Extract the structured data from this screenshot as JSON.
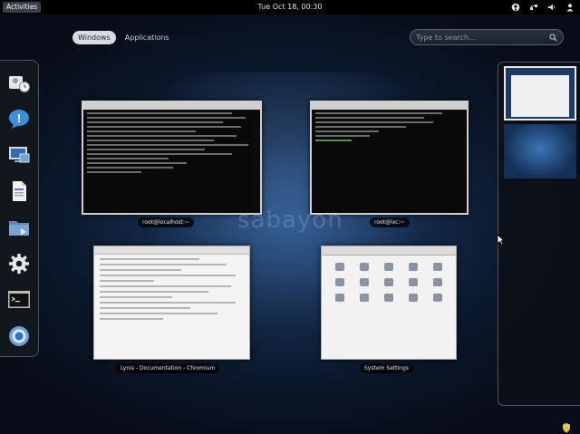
{
  "top_panel": {
    "activities": "Activities",
    "clock": "Tue Oct 18, 00:30"
  },
  "view_tabs": [
    {
      "label": "Windows",
      "active": true
    },
    {
      "label": "Applications",
      "active": false
    }
  ],
  "search": {
    "placeholder": "Type to search..."
  },
  "dash": {
    "icons": [
      "contacts-icon",
      "chat-icon",
      "display-icon",
      "document-icon",
      "folder-icon",
      "settings-gear-icon",
      "terminal-icon",
      "chrome-icon"
    ]
  },
  "windows": [
    {
      "label": "root@localhost:~",
      "type": "terminal"
    },
    {
      "label": "root@lxc:~",
      "type": "terminal"
    },
    {
      "label": "Lynis - Documentation - Chromium",
      "type": "browser"
    },
    {
      "label": "System Settings",
      "type": "settings"
    }
  ],
  "watermark": "sabayon",
  "colors": {
    "panel": "#000000",
    "background": "#1b3a63",
    "tab_active": "#d9dde3"
  }
}
